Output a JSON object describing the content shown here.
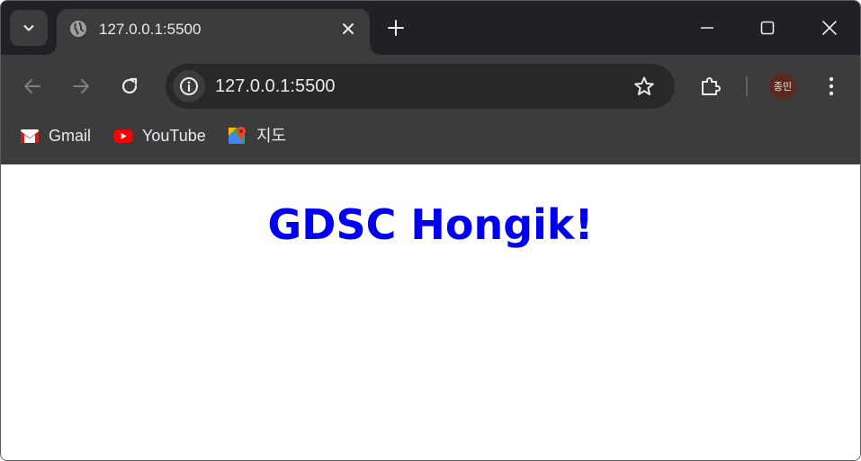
{
  "tab": {
    "title": "127.0.0.1:5500",
    "favicon": "globe-icon"
  },
  "omnibox": {
    "url": "127.0.0.1:5500"
  },
  "profile": {
    "avatar_text": "종민",
    "avatar_color": "#5a2a20"
  },
  "bookmarks": [
    {
      "label": "Gmail",
      "icon": "gmail-icon"
    },
    {
      "label": "YouTube",
      "icon": "youtube-icon"
    },
    {
      "label": "지도",
      "icon": "maps-icon"
    }
  ],
  "page": {
    "heading": "GDSC Hongik!",
    "heading_color": "#0000ee"
  },
  "theme": {
    "tabstrip_bg": "#202124",
    "toolbar_bg": "#3c3c3c",
    "omnibox_bg": "#282828",
    "text": "#e8eaed"
  }
}
